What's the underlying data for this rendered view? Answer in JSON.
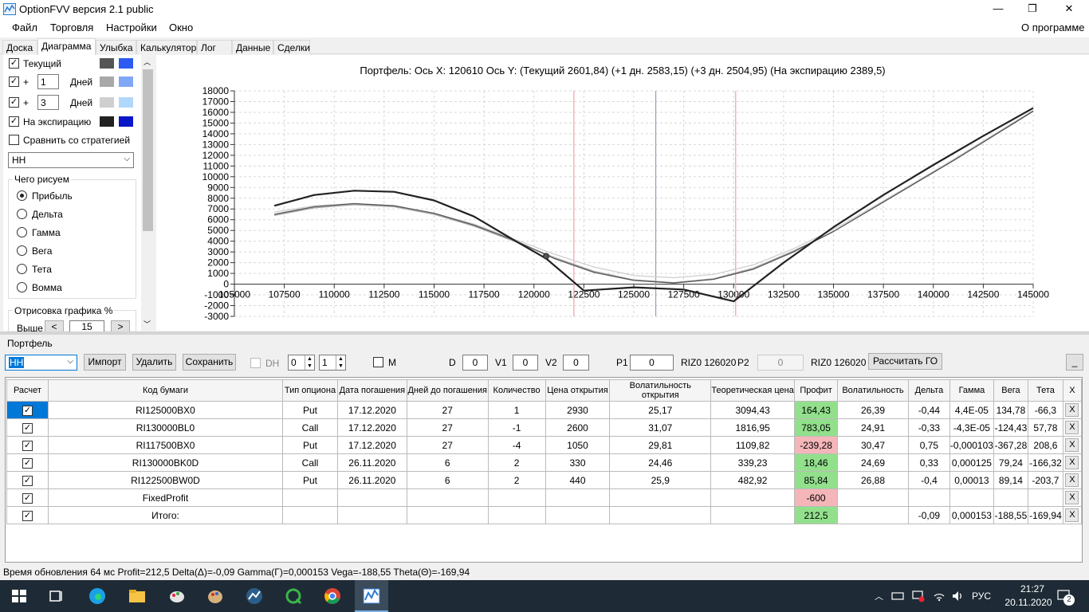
{
  "window": {
    "title": "OptionFVV версия 2.1 public",
    "minimize": "—",
    "maximize": "❐",
    "close": "✕"
  },
  "menu": {
    "items": [
      "Файл",
      "Торговля",
      "Настройки",
      "Окно"
    ],
    "about": "О программе"
  },
  "tabs": [
    "Доска",
    "Диаграмма",
    "Улыбка",
    "Калькулятор",
    "Лог",
    "Данные",
    "Сделки"
  ],
  "left": {
    "current": "Текущий",
    "plus": "+",
    "days": "Дней",
    "days1": "1",
    "days2": "3",
    "expiry": "На экспирацию",
    "compare": "Сравнить со стратегией",
    "strategy": "HH",
    "what_title": "Чего рисуем",
    "what_options": [
      "Прибыль",
      "Дельта",
      "Гамма",
      "Вега",
      "Тета",
      "Вомма"
    ],
    "draw_title": "Отрисовка графика %",
    "above": "Выше",
    "above_val": "15",
    "colors": {
      "cur_dark": "#555555",
      "cur_blue": "#2d5bef",
      "d1_gray": "#a8a8a8",
      "d1_blue": "#7fa7f5",
      "d3_gray": "#cfcfcf",
      "d3_blue": "#b0d8fb",
      "exp_dark": "#222222",
      "exp_blue": "#0a17c8"
    }
  },
  "chart": {
    "header": "Портфель: Ось X: 120610 Ось Y: (Текущий 2601,84) (+1 дн. 2583,15) (+3 дн. 2504,95) (На экспирацию 2389,5)"
  },
  "chart_data": {
    "type": "line",
    "xlim": [
      105000,
      145000
    ],
    "ylim": [
      -3000,
      18000
    ],
    "x_ticks": [
      "105000",
      "107500",
      "110000",
      "112500",
      "115000",
      "117500",
      "120000",
      "122500",
      "125000",
      "127500",
      "130000",
      "132500",
      "135000",
      "137500",
      "140000",
      "142500",
      "145000"
    ],
    "y_ticks": [
      "18000",
      "17000",
      "16000",
      "15000",
      "14000",
      "13000",
      "12000",
      "11000",
      "10000",
      "9000",
      "8000",
      "7000",
      "6000",
      "5000",
      "4000",
      "3000",
      "2000",
      "1000",
      "0",
      "-1000",
      "-2000",
      "-3000"
    ],
    "vlines": [
      {
        "x": 122000,
        "color": "#f3a7b0"
      },
      {
        "x": 126100,
        "color": "#9aa3b5"
      },
      {
        "x": 130100,
        "color": "#f3a7b0"
      }
    ],
    "marker": {
      "x": 120610,
      "y": 2602
    },
    "series": [
      {
        "color": "#cfcfcf",
        "x": [
          107000,
          109000,
          111000,
          113000,
          115000,
          117000,
          119000,
          121000,
          123000,
          125000,
          127000,
          129000,
          131000,
          133000,
          135000,
          137000,
          139000,
          141000,
          143000,
          145000
        ],
        "y": [
          6700,
          7300,
          7500,
          7300,
          6600,
          5600,
          4200,
          2800,
          1600,
          800,
          600,
          900,
          1800,
          3300,
          5100,
          7200,
          9400,
          11600,
          13900,
          16200
        ]
      },
      {
        "color": "#a8a8a8",
        "x": [
          107000,
          109000,
          111000,
          113000,
          115000,
          117000,
          119000,
          121000,
          123000,
          125000,
          127000,
          129000,
          131000,
          133000,
          135000,
          137000,
          139000,
          141000,
          143000,
          145000
        ],
        "y": [
          6400,
          7100,
          7400,
          7200,
          6500,
          5400,
          4000,
          2500,
          1200,
          400,
          150,
          500,
          1500,
          3100,
          4900,
          7100,
          9300,
          11500,
          13800,
          16100
        ]
      },
      {
        "color": "#555555",
        "x": [
          107000,
          109000,
          111000,
          113000,
          115000,
          117000,
          119000,
          121000,
          123000,
          125000,
          127000,
          129000,
          131000,
          133000,
          135000,
          137000,
          139000,
          141000,
          143000,
          145000
        ],
        "y": [
          6500,
          7200,
          7500,
          7300,
          6600,
          5500,
          4100,
          2400,
          1100,
          350,
          100,
          450,
          1400,
          3000,
          4900,
          7100,
          9300,
          11500,
          13800,
          16100
        ]
      },
      {
        "color": "#222222",
        "x": [
          107000,
          109000,
          111000,
          113000,
          115000,
          117000,
          119000,
          120610,
          122500,
          125000,
          127500,
          130000,
          132500,
          135000,
          137500,
          140000,
          142500,
          145000
        ],
        "y": [
          7300,
          8300,
          8700,
          8600,
          7800,
          6300,
          4100,
          2390,
          -600,
          -300,
          -500,
          -1600,
          2000,
          5300,
          8300,
          11100,
          13800,
          16400
        ]
      }
    ]
  },
  "portfolio": {
    "label": "Портфель",
    "combo": "HH",
    "import": "Импорт",
    "delete": "Удалить",
    "save": "Сохранить",
    "dh": "DH",
    "dh1": "0",
    "dh2": "1",
    "m": "M",
    "d": "D",
    "d_val": "0",
    "v1": "V1",
    "v1_val": "0",
    "v2": "V2",
    "v2_val": "0",
    "p1": "P1",
    "p1_val": "0",
    "fut1": "RIZ0 126020",
    "p2": "P2",
    "p2_val": "0",
    "fut2": "RIZ0 126020",
    "calc_go": "Рассчитать ГО",
    "collapse": "_"
  },
  "table": {
    "headers": [
      "Расчет",
      "Код бумаги",
      "Тип опциона",
      "Дата погашения",
      "Дней до погашения",
      "Количество",
      "Цена открытия",
      "Волатильность открытия",
      "Теоретическая цена",
      "Профит",
      "Волатильность",
      "Дельта",
      "Гамма",
      "Вега",
      "Тета",
      "X"
    ],
    "rows": [
      {
        "code": "RI125000BX0",
        "type": "Put",
        "date": "17.12.2020",
        "days": "27",
        "qty": "1",
        "price": "2930",
        "vol_open": "25,17",
        "theo": "3094,43",
        "profit": "164,43",
        "profit_sign": "pos",
        "vol": "26,39",
        "delta": "-0,44",
        "gamma": "4,4E-05",
        "vega": "134,78",
        "theta": "-66,3",
        "x": "X"
      },
      {
        "code": "RI130000BL0",
        "type": "Call",
        "date": "17.12.2020",
        "days": "27",
        "qty": "-1",
        "price": "2600",
        "vol_open": "31,07",
        "theo": "1816,95",
        "profit": "783,05",
        "profit_sign": "pos",
        "vol": "24,91",
        "delta": "-0,33",
        "gamma": "-4,3E-05",
        "vega": "-124,43",
        "theta": "57,78",
        "x": "X"
      },
      {
        "code": "RI117500BX0",
        "type": "Put",
        "date": "17.12.2020",
        "days": "27",
        "qty": "-4",
        "price": "1050",
        "vol_open": "29,81",
        "theo": "1109,82",
        "profit": "-239,28",
        "profit_sign": "neg",
        "vol": "30,47",
        "delta": "0,75",
        "gamma": "-0,000103",
        "vega": "-367,28",
        "theta": "208,6",
        "x": "X"
      },
      {
        "code": "RI130000BK0D",
        "type": "Call",
        "date": "26.11.2020",
        "days": "6",
        "qty": "2",
        "price": "330",
        "vol_open": "24,46",
        "theo": "339,23",
        "profit": "18,46",
        "profit_sign": "pos",
        "vol": "24,69",
        "delta": "0,33",
        "gamma": "0,000125",
        "vega": "79,24",
        "theta": "-166,32",
        "x": "X"
      },
      {
        "code": "RI122500BW0D",
        "type": "Put",
        "date": "26.11.2020",
        "days": "6",
        "qty": "2",
        "price": "440",
        "vol_open": "25,9",
        "theo": "482,92",
        "profit": "85,84",
        "profit_sign": "pos",
        "vol": "26,88",
        "delta": "-0,4",
        "gamma": "0,00013",
        "vega": "89,14",
        "theta": "-203,7",
        "x": "X"
      },
      {
        "code": "FixedProfit",
        "type": "",
        "date": "",
        "days": "",
        "qty": "",
        "price": "",
        "vol_open": "",
        "theo": "",
        "profit": "-600",
        "profit_sign": "neg",
        "vol": "",
        "delta": "",
        "gamma": "",
        "vega": "",
        "theta": "",
        "x": "X"
      },
      {
        "code": "Итого:",
        "type": "",
        "date": "",
        "days": "",
        "qty": "",
        "price": "",
        "vol_open": "",
        "theo": "",
        "profit": "212,5",
        "profit_sign": "pos",
        "vol": "",
        "delta": "-0,09",
        "gamma": "0,000153",
        "vega": "-188,55",
        "theta": "-169,94",
        "x": "X"
      }
    ]
  },
  "status": "Время обновления 64 мс   Profit=212,5 Delta(Δ)=-0,09 Gamma(Γ)=0,000153 Vega=-188,55 Theta(Θ)=-169,94",
  "taskbar": {
    "lang": "РУС",
    "time": "21:27",
    "date": "20.11.2020",
    "notif": "2"
  }
}
